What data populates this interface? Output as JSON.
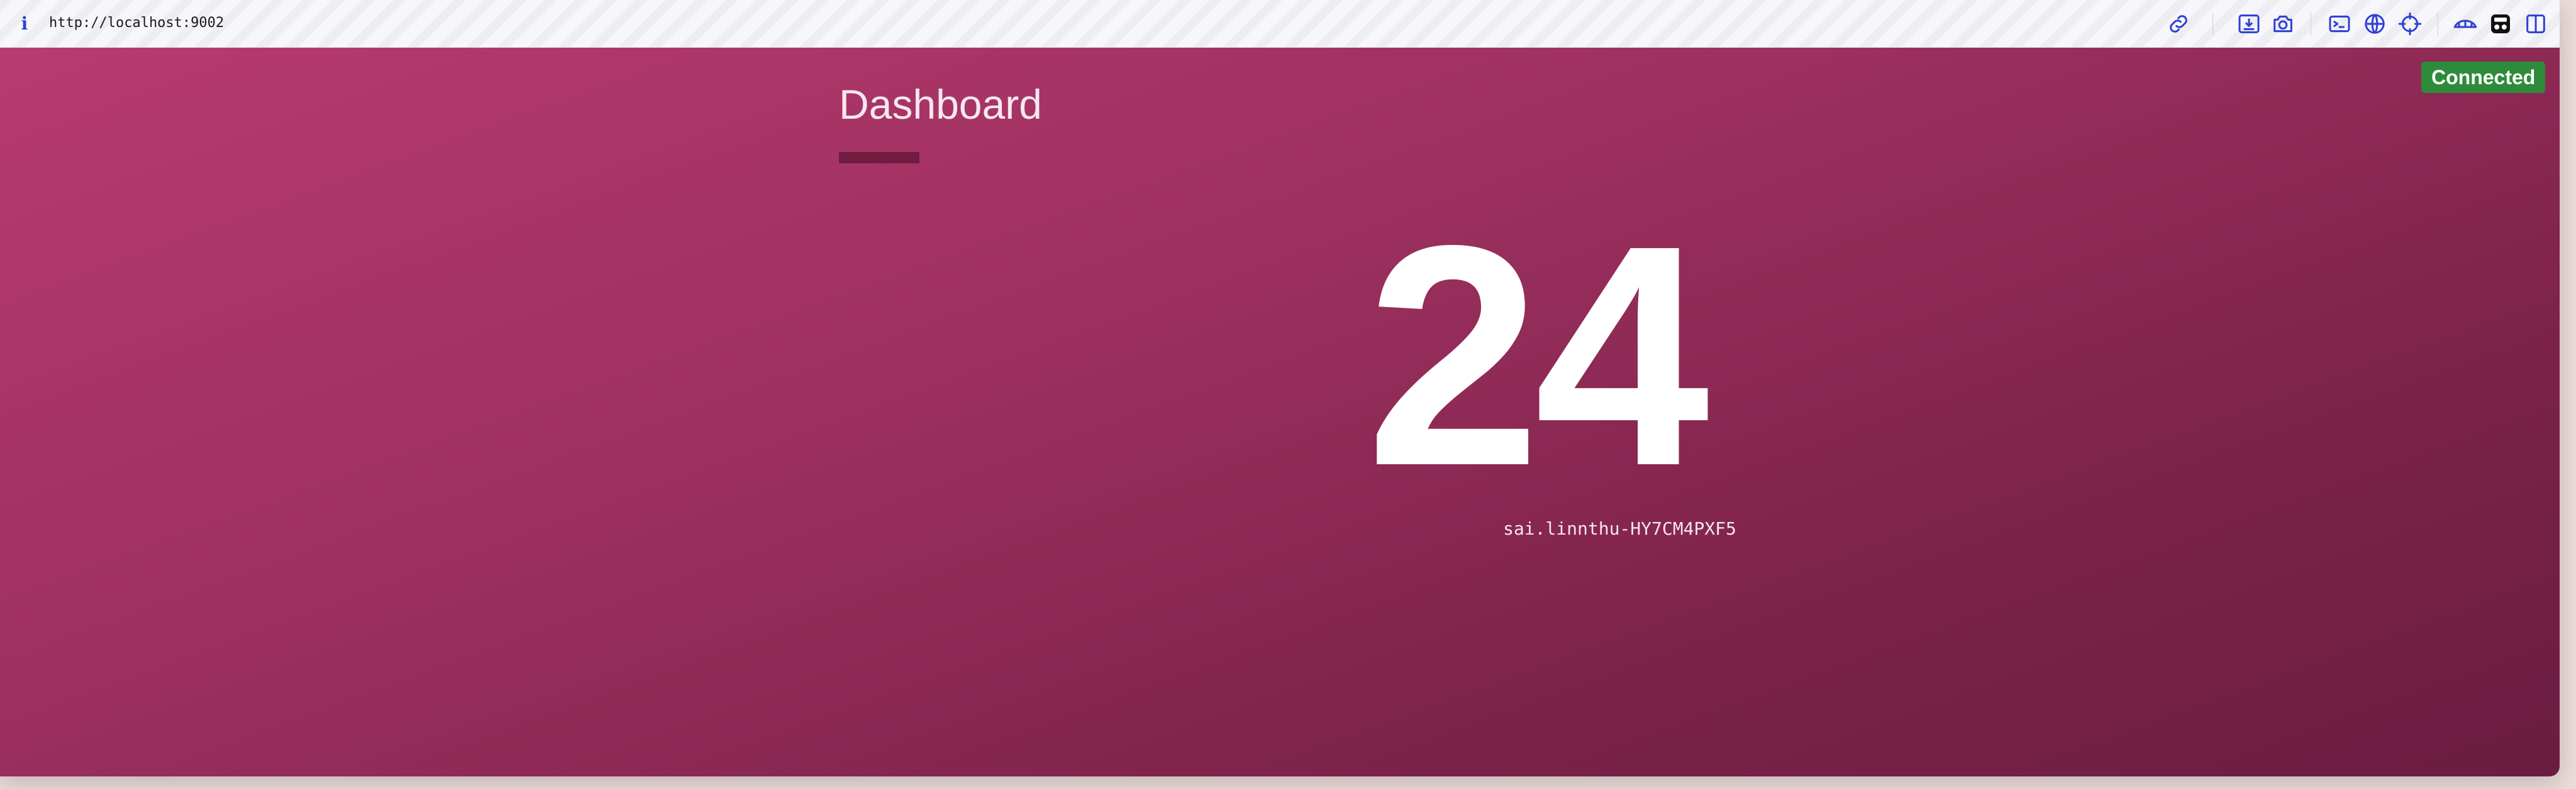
{
  "browser": {
    "url": "http://localhost:9002",
    "info_icon": "ⅰ",
    "icons": [
      "link-icon",
      "save-icon",
      "camera-icon",
      "terminal-icon",
      "globe-icon",
      "crosshair-icon",
      "bridge-icon",
      "incognito-icon",
      "split-panel-icon"
    ]
  },
  "dashboard": {
    "title": "Dashboard",
    "value": "24",
    "user_id": "sai.linnthu-HY7CM4PXF5",
    "status": "Connected"
  },
  "colors": {
    "accent": "#2f3fd4",
    "status_green": "#2e8b3a",
    "gradient_start": "#b83a70",
    "gradient_end": "#6a1d40"
  }
}
